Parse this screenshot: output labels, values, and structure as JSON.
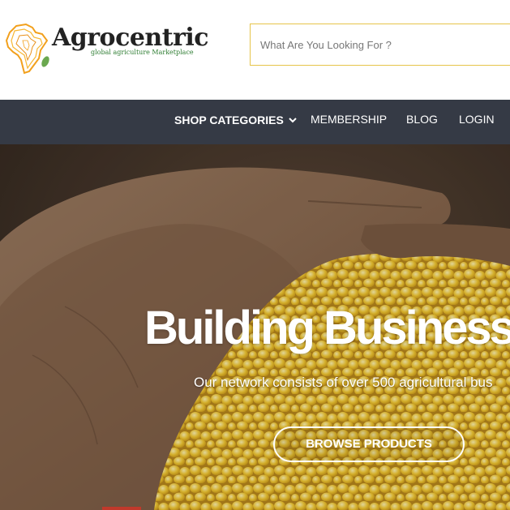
{
  "header": {
    "logo": {
      "name": "Agrocentric",
      "tagline": "global agriculture Marketplace",
      "icon": "africa-map-icon"
    },
    "search": {
      "placeholder": "What Are You Looking For ?",
      "value": "",
      "border_color": "#e6c44a"
    }
  },
  "nav": {
    "background": "#353a45",
    "items": [
      {
        "label": "SHOP CATEGORIES",
        "icon": "chevron-down-icon"
      },
      {
        "label": "MEMBERSHIP"
      },
      {
        "label": "BLOG"
      },
      {
        "label": "LOGIN"
      }
    ]
  },
  "hero": {
    "title": "Building Business",
    "subtitle": "Our network consists of over 500 agricultural bus",
    "cta_label": "BROWSE PRODUCTS",
    "accent": "#c0392b"
  }
}
